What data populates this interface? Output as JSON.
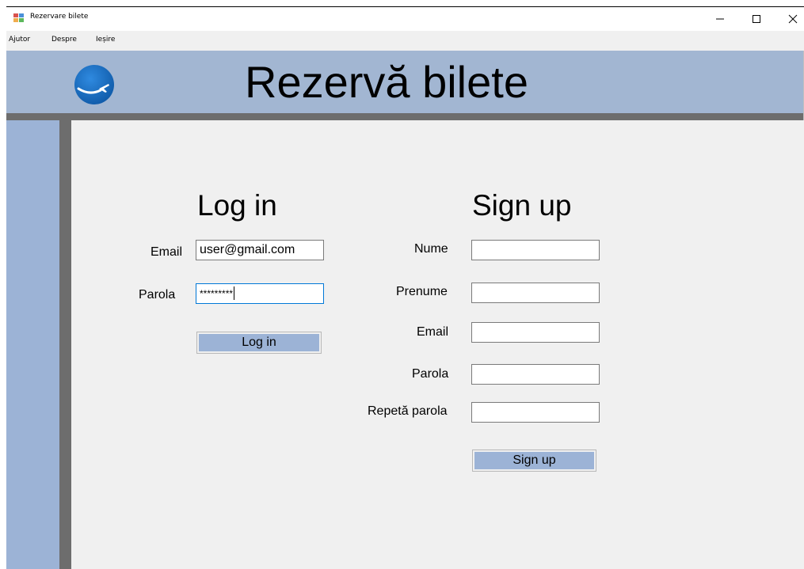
{
  "window": {
    "title": "Rezervare bilete",
    "minimize_glyph": "—",
    "maximize_glyph": "☐",
    "close_glyph": "✕"
  },
  "menu": {
    "items": [
      "Ajutor",
      "Despre",
      "Ieșire"
    ]
  },
  "header": {
    "title": "Rezervă bilete",
    "logo_icon": "airplane-globe-icon"
  },
  "login": {
    "title": "Log in",
    "email_label": "Email",
    "email_value": "user@gmail.com",
    "password_label": "Parola",
    "password_value": "*********",
    "button_label": "Log in"
  },
  "signup": {
    "title": "Sign up",
    "nume_label": "Nume",
    "prenume_label": "Prenume",
    "email_label": "Email",
    "parola_label": "Parola",
    "repeat_label": "Repetă parola",
    "nume_value": "",
    "prenume_value": "",
    "email_value": "",
    "parola_value": "",
    "repeat_value": "",
    "button_label": "Sign up"
  },
  "colors": {
    "banner": "#a2b6d2",
    "sidebar": "#9cb3d6",
    "frame": "#6d6d6d",
    "content_bg": "#f0f0f0",
    "logo_blue": "#1d6fc0",
    "focus_border": "#0078d7"
  }
}
